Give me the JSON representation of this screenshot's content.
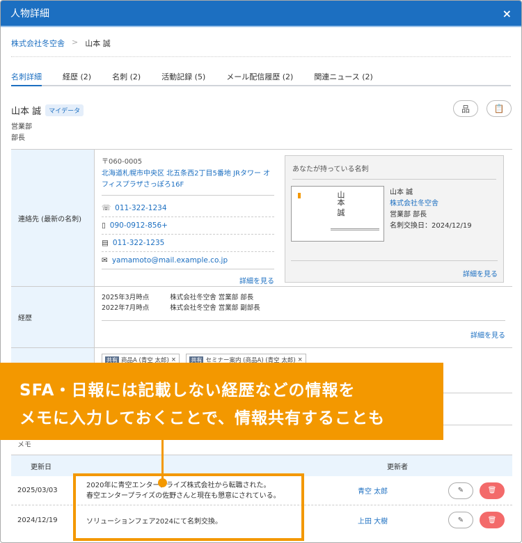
{
  "window": {
    "title": "人物詳細",
    "close": "×"
  },
  "breadcrumb": {
    "company": "株式会社冬空舎",
    "sep": ">",
    "person": "山本 誠"
  },
  "tabs": [
    {
      "label": "名刺詳細"
    },
    {
      "label": "経歴 (2)"
    },
    {
      "label": "名刺 (2)"
    },
    {
      "label": "活動記録 (5)"
    },
    {
      "label": "メール配信履歴 (2)"
    },
    {
      "label": "関連ニュース (2)"
    }
  ],
  "person": {
    "name": "山本 誠",
    "tag": "マイデータ",
    "dept": "営業部",
    "title": "部長"
  },
  "contact": {
    "label": "連絡先 (最新の名刺)",
    "zip": "〒060-0005",
    "address": "北海道札幌市中央区 北五条西2丁目5番地 JRタワー オフィスプラザさっぽろ16F",
    "tel": "011-322-1234",
    "mobile": "090-0912-856+",
    "fax": "011-322-1235",
    "email": "yamamoto@mail.example.co.jp",
    "more": "詳細を見る"
  },
  "card": {
    "heading": "あなたが持っている名刺",
    "name": "山本 誠",
    "company": "株式会社冬空舎",
    "position": "営業部 部長",
    "exchanged": "名刺交換日：2024/12/19",
    "more": "詳細を見る"
  },
  "career": {
    "label": "経歴",
    "items": [
      {
        "date": "2025年3月時点",
        "text": "株式会社冬空舎 営業部 部長"
      },
      {
        "date": "2022年7月時点",
        "text": "株式会社冬空舎 営業部 副部長"
      }
    ],
    "more": "詳細を見る"
  },
  "chips": [
    {
      "badge": "共有",
      "text": "商品A (青空 太郎)"
    },
    {
      "badge": "共有",
      "text": "セミナー案内 (商品A) (青空 太郎)"
    }
  ],
  "memo": {
    "label": "メモ",
    "headers": {
      "date": "更新日",
      "updater": "更新者"
    },
    "rows": [
      {
        "date": "2025/03/03",
        "text1": "2020年に青空エンタープライズ株式会社から転職された。",
        "text2": "春空エンタープライズの佐野さんと現在も懇意にされている。",
        "updater": "青空 太郎"
      },
      {
        "date": "2024/12/19",
        "text1": "ソリューションフェア2024にて名刺交換。",
        "text2": "",
        "updater": "上田 大樹"
      }
    ]
  },
  "callout": {
    "line1": "SFA・日報には記載しない経歴などの情報を",
    "line2": "メモに入力しておくことで、情報共有することも"
  },
  "colors": {
    "primary": "#1c6fc1",
    "accent": "#f39800",
    "danger": "#f36a6a"
  }
}
